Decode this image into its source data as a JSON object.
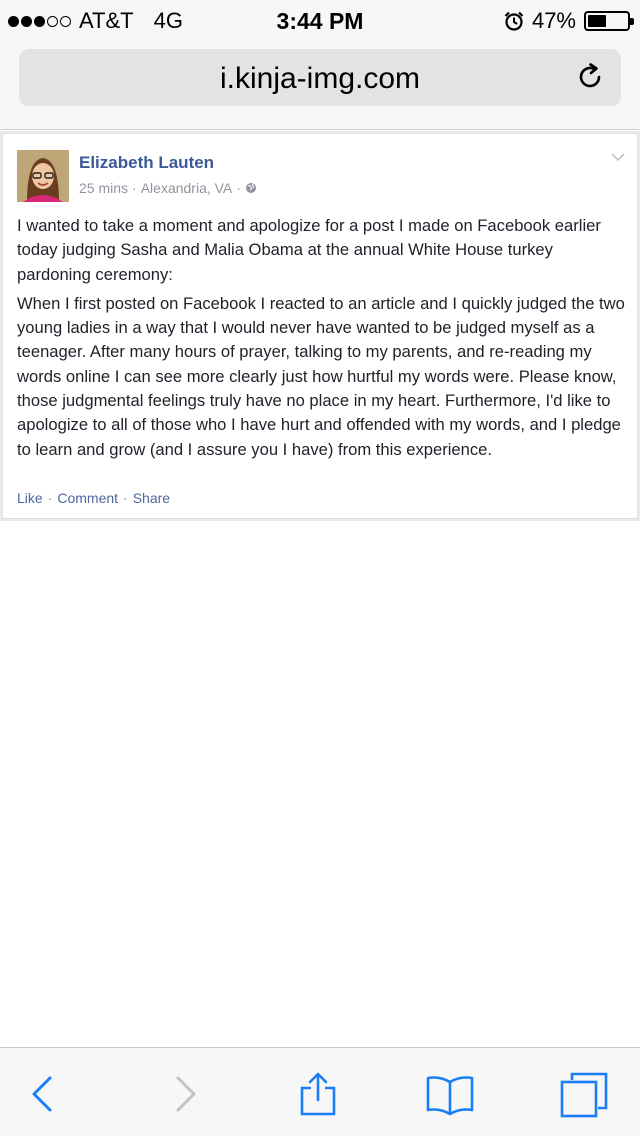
{
  "status_bar": {
    "carrier": "AT&T",
    "network": "4G",
    "time": "3:44 PM",
    "battery_percent": "47%",
    "battery_level": 0.47,
    "signal_bars_filled": 3,
    "signal_bars_total": 5
  },
  "browser": {
    "url": "i.kinja-img.com"
  },
  "post": {
    "author": "Elizabeth Lauten",
    "time_ago": "25 mins",
    "dot1": "·",
    "location": "Alexandria, VA",
    "dot2": "·",
    "paragraph1": "I wanted to take a moment and apologize for a post I made on Facebook earlier today judging Sasha and Malia Obama at the annual White House turkey pardoning ceremony:",
    "paragraph2": "When I first posted on Facebook I reacted to an article and I quickly judged the two young ladies in a way that I would never have wanted to be judged myself as a teenager. After many hours of prayer, talking to my parents, and re-reading my words online I can see more clearly just how hurtful my words were. Please know, those judgmental feelings truly have no place in my heart. Furthermore, I'd like to apologize to all of those who I have hurt and offended with my words, and I pledge to learn and grow (and I assure you I have) from this experience.",
    "actions": {
      "like": "Like",
      "comment": "Comment",
      "share": "Share",
      "separator": "·"
    }
  },
  "colors": {
    "facebook_blue": "#3b5998",
    "ios_blue": "#1a7ef6",
    "disabled_gray": "#c3c3c7"
  },
  "icons": [
    "reload-icon",
    "chevron-down-icon",
    "globe-icon",
    "alarm-icon",
    "back-icon",
    "forward-icon",
    "share-icon",
    "bookmarks-icon",
    "tabs-icon"
  ]
}
